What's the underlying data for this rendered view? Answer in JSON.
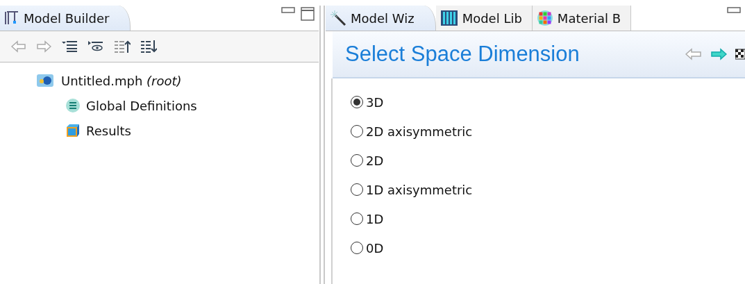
{
  "left_panel": {
    "tab": {
      "label": "Model Builder",
      "selected": true
    },
    "tree": [
      {
        "label": "Untitled.mph *(root)*",
        "children": [
          {
            "label": "Global Definitions"
          },
          {
            "label": "Results"
          }
        ]
      }
    ]
  },
  "right_panel": {
    "tabs": [
      {
        "label": "Model Wiz",
        "selected": true
      },
      {
        "label": "Model Lib",
        "selected": false
      },
      {
        "label": "Material B",
        "selected": false
      }
    ],
    "title": "Select Space Dimension",
    "options": [
      {
        "label": "3D",
        "selected": true
      },
      {
        "label": "2D axisymmetric",
        "selected": false
      },
      {
        "label": "2D",
        "selected": false
      },
      {
        "label": "1D axisymmetric",
        "selected": false
      },
      {
        "label": "1D",
        "selected": false
      },
      {
        "label": "0D",
        "selected": false
      }
    ]
  }
}
